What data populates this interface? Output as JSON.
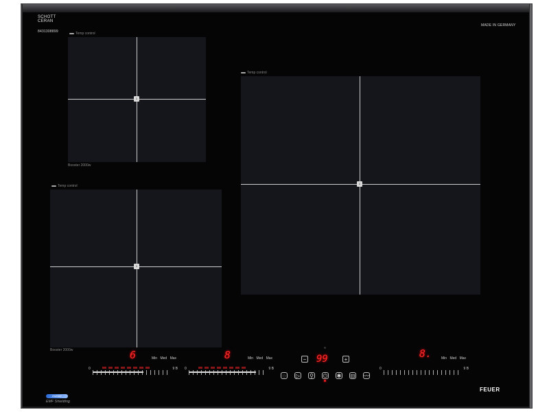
{
  "hob": {
    "brand_top_line1": "SCHOTT",
    "brand_top_line2": "CERAN",
    "serial": "8431308899",
    "made_in": "MADE IN GERMANY",
    "inverter_logo": "Inverter",
    "emf_shielding": "EMF Shielding",
    "brand": "FEUER"
  },
  "zones": {
    "top_left": {
      "label_top": "Temp control",
      "label_bottom": "Booster 2000w",
      "center_mark": "1"
    },
    "left": {
      "label_top": "Temp control",
      "label_bottom": "Booster 2000w",
      "center_mark": "1"
    },
    "right": {
      "label_top": "Temp control",
      "center_mark": "1"
    }
  },
  "controls": {
    "zone1": {
      "display": "6",
      "min": "Min",
      "med": "Med",
      "max": "Max",
      "scale_min": "0",
      "scale_max": "9 B",
      "level_fraction": 0.67
    },
    "zone2": {
      "display": "8",
      "min": "Min",
      "med": "Med",
      "max": "Max",
      "scale_min": "0",
      "scale_max": "9 B",
      "level_fraction": 0.89
    },
    "zone3": {
      "display": "8.",
      "min": "Min",
      "med": "Med",
      "max": "Max",
      "scale_min": "0",
      "scale_max": "9 B",
      "level_fraction": 0.0
    },
    "timer": {
      "minus": "−",
      "display": "99",
      "plus": "+"
    },
    "function_buttons": [
      {
        "name": "keep-warm-icon",
        "glyph": "◌"
      },
      {
        "name": "pause-icon",
        "glyph": "▷"
      },
      {
        "name": "lock-icon",
        "glyph": "⚲"
      },
      {
        "name": "power-icon",
        "glyph": "⏻"
      },
      {
        "name": "boost-icon",
        "glyph": "✱"
      },
      {
        "name": "bridge-icon",
        "glyph": "⊟"
      },
      {
        "name": "temp-control-icon",
        "glyph": "〰"
      }
    ]
  }
}
